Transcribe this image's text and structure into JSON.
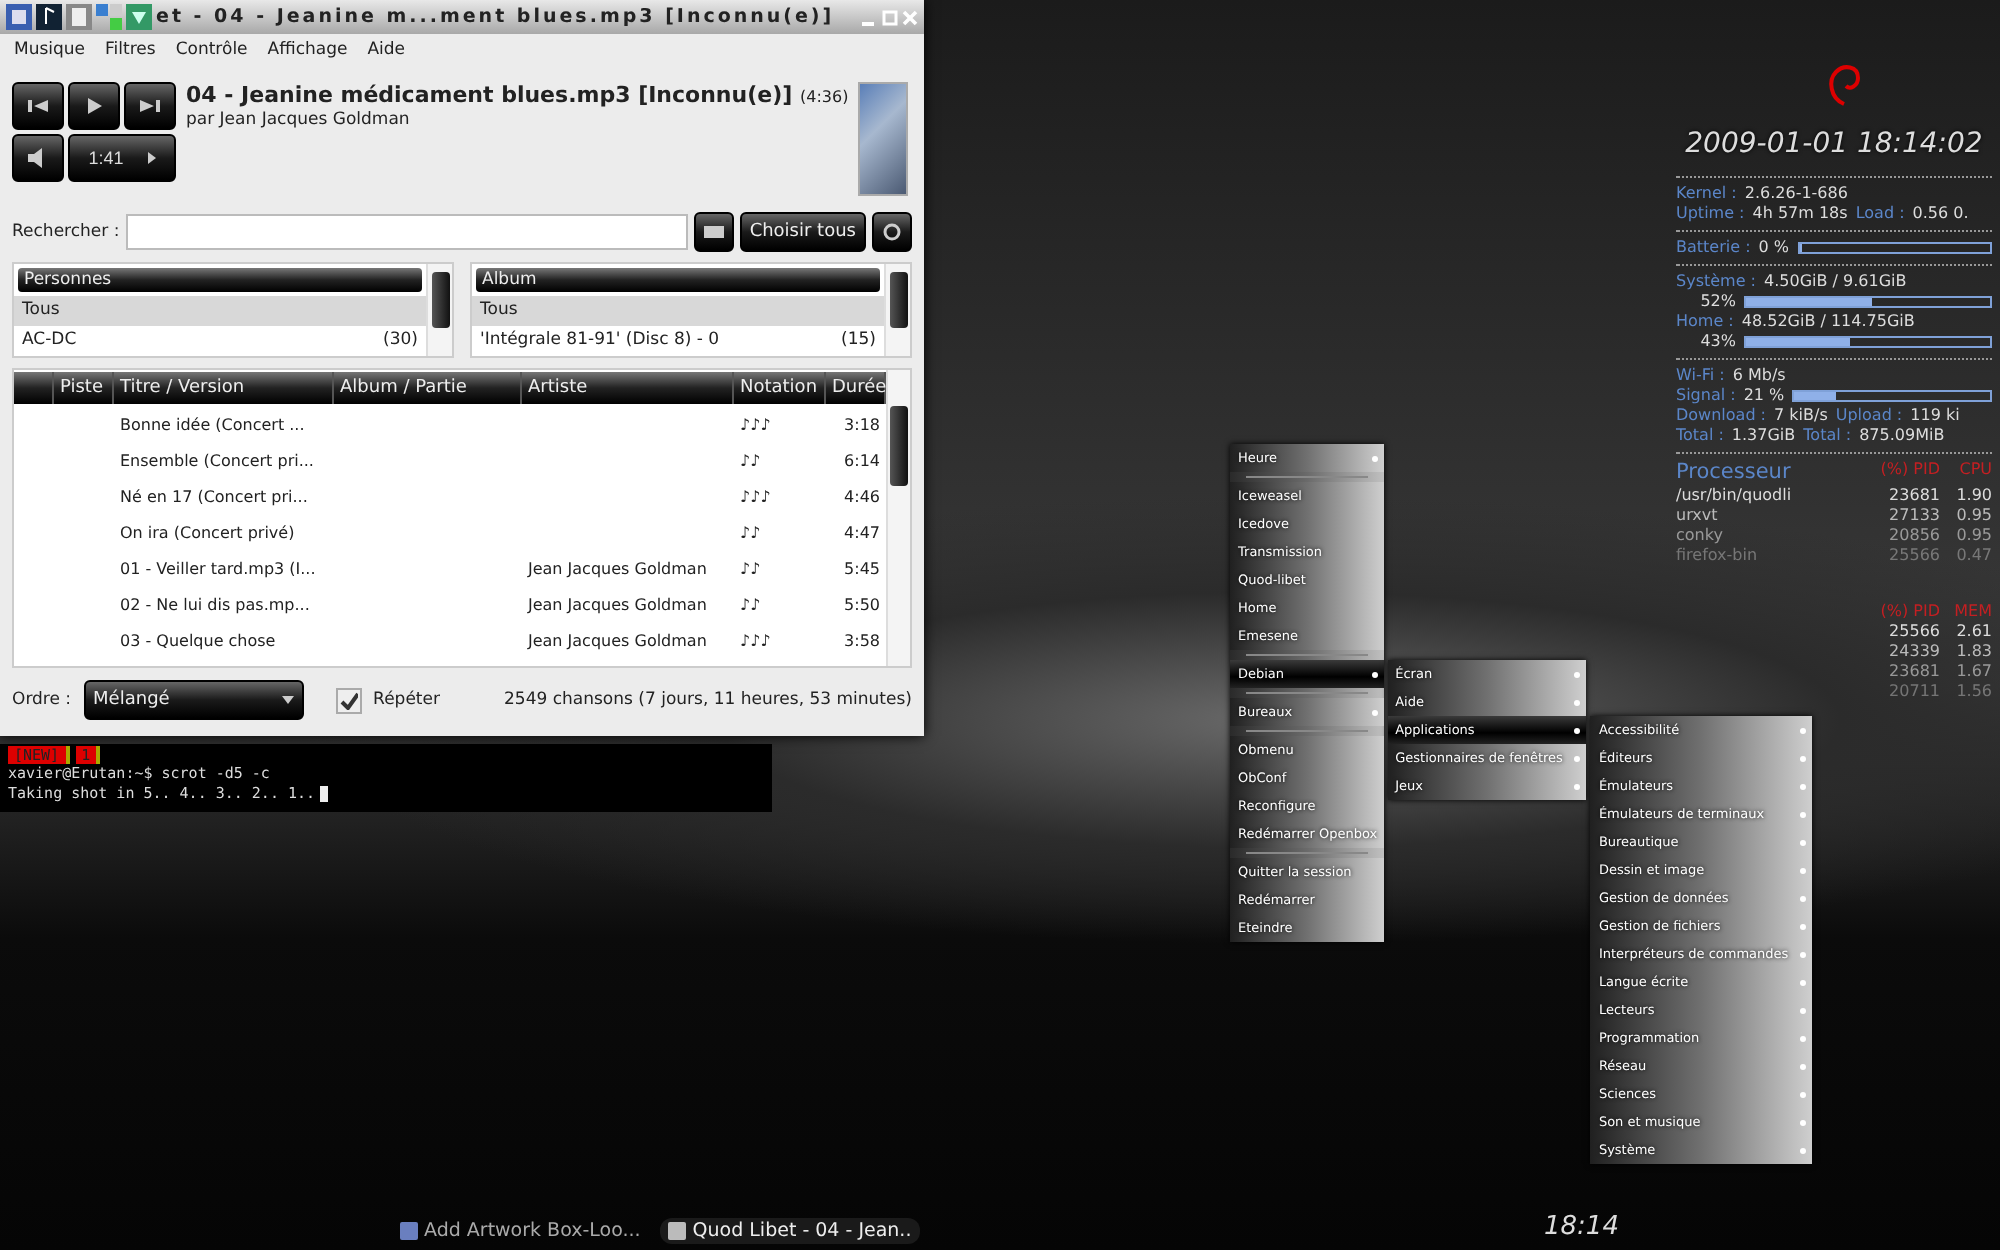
{
  "player": {
    "title": "et - 04 - Jeanine m...ment blues.mp3 [Inconnu(e)]",
    "menu": [
      "Musique",
      "Filtres",
      "Contrôle",
      "Affichage",
      "Aide"
    ],
    "song": {
      "title": "04 - Jeanine médicament blues.mp3 [Inconnu(e)]",
      "length": "(4:36)",
      "artist": "par Jean Jacques Goldman"
    },
    "position": "1:41",
    "search": {
      "label": "Rechercher :",
      "button": "Choisir tous"
    },
    "panes": [
      {
        "heading": "Personnes",
        "items": [
          {
            "name": "Tous",
            "selected": true
          },
          {
            "name": "AC-DC",
            "count": "(30)",
            "selected": false
          }
        ]
      },
      {
        "heading": "Album",
        "items": [
          {
            "name": "Tous",
            "selected": true
          },
          {
            "name": "'Intégrale 81-91' (Disc 8) - 0",
            "count": "(15)",
            "selected": false
          }
        ]
      }
    ],
    "columns": [
      "Piste",
      "Titre / Version",
      "Album / Partie",
      "Artiste",
      "Notation",
      "Durée"
    ],
    "rows": [
      {
        "title": "Bonne idée (Concert ...",
        "rating": "♪♪♪",
        "duration": "3:18"
      },
      {
        "title": "Ensemble (Concert pri...",
        "rating": "♪♪",
        "duration": "6:14"
      },
      {
        "title": "Né en 17 (Concert pri...",
        "rating": "♪♪♪",
        "duration": "4:46"
      },
      {
        "title": "On ira (Concert privé)",
        "rating": "♪♪",
        "duration": "4:47"
      },
      {
        "title": "01 - Veiller tard.mp3 (I...",
        "artist": "Jean Jacques Goldman",
        "rating": "♪♪",
        "duration": "5:45"
      },
      {
        "title": "02 - Ne lui dis pas.mp...",
        "artist": "Jean Jacques Goldman",
        "rating": "♪♪",
        "duration": "5:50"
      },
      {
        "title": "03 - Quelque chose",
        "artist": "Jean Jacques Goldman",
        "rating": "♪♪♪",
        "duration": "3:58"
      }
    ],
    "order": {
      "label": "Ordre :",
      "value": "Mélangé"
    },
    "repeat": {
      "label": "Répéter",
      "checked": true
    },
    "status": "2549 chansons (7 jours, 11 heures, 53 minutes)"
  },
  "terminal": {
    "tags": [
      "[NEW]",
      "1"
    ],
    "lines": [
      "xavier@Erutan:~$ scrot -d5 -c",
      "Taking shot in 5.. 4.. 3.. 2.. 1.."
    ]
  },
  "conky": {
    "datetime": "2009-01-01 18:14:02",
    "groups": [
      [
        {
          "kind": "text",
          "parts": [
            {
              "label": "Kernel :",
              "value": "2.6.26-1-686"
            }
          ]
        },
        {
          "kind": "text",
          "parts": [
            {
              "label": "Uptime :",
              "value": "4h 57m 18s"
            },
            {
              "label": "Load :",
              "value": "0.56 0."
            }
          ]
        }
      ],
      [
        {
          "kind": "bar",
          "label": "Batterie :",
          "value": "0 %",
          "level": 0
        }
      ],
      [
        {
          "kind": "text",
          "parts": [
            {
              "label": "Système :",
              "value": "4.50GiB / 9.61GiB"
            }
          ]
        },
        {
          "kind": "pct",
          "value": "52%",
          "level": 0.52
        },
        {
          "kind": "text",
          "parts": [
            {
              "label": "Home :",
              "value": "48.52GiB / 114.75GiB"
            }
          ]
        },
        {
          "kind": "pct",
          "value": "43%",
          "level": 0.43
        }
      ],
      [
        {
          "kind": "text",
          "parts": [
            {
              "label": "Wi-Fi :",
              "value": "6 Mb/s"
            }
          ]
        },
        {
          "kind": "bar",
          "label": "Signal :",
          "value": "21 %",
          "level": 0.21
        },
        {
          "kind": "text",
          "parts": [
            {
              "label": "Download :",
              "value": "7 kiB/s"
            },
            {
              "label": "Upload :",
              "value": "119 ki"
            }
          ]
        },
        {
          "kind": "text",
          "parts": [
            {
              "label": "Total :",
              "value": "1.37GiB"
            },
            {
              "label": "Total :",
              "value": "875.09MiB"
            }
          ]
        }
      ]
    ],
    "tables": [
      {
        "title": "Processeur",
        "headers": [
          "(%) PID",
          "CPU"
        ],
        "rows": [
          {
            "name": "/usr/bin/quodli",
            "pid": "23681",
            "value": "1.90"
          },
          {
            "name": "urxvt",
            "pid": "27133",
            "value": "0.95"
          },
          {
            "name": "conky",
            "pid": "20856",
            "value": "0.95"
          },
          {
            "name": "firefox-bin",
            "pid": "25566",
            "value": "0.47"
          }
        ]
      },
      {
        "headers": [
          "(%) PID",
          "MEM"
        ],
        "rows": [
          {
            "pid": "25566",
            "value": "2.61"
          },
          {
            "pid": "24339",
            "value": "1.83"
          },
          {
            "pid": "23681",
            "value": "1.67"
          },
          {
            "pid": "20711",
            "value": "1.56"
          }
        ]
      }
    ]
  },
  "menu": [
    {
      "kind": "submenu",
      "label": "Heure",
      "selected": false
    },
    {
      "kind": "separator"
    },
    {
      "kind": "item",
      "label": "Iceweasel",
      "selected": false
    },
    {
      "kind": "item",
      "label": "Icedove",
      "selected": false
    },
    {
      "kind": "item",
      "label": "Transmission",
      "selected": false
    },
    {
      "kind": "item",
      "label": "Quod-libet",
      "selected": false
    },
    {
      "kind": "item",
      "label": "Home",
      "selected": false
    },
    {
      "kind": "item",
      "label": "Emesene",
      "selected": false
    },
    {
      "kind": "separator"
    },
    {
      "kind": "submenu",
      "label": "Debian",
      "selected": true,
      "children": [
        {
          "kind": "submenu",
          "label": "Écran",
          "selected": false
        },
        {
          "kind": "submenu",
          "label": "Aide",
          "selected": false
        },
        {
          "kind": "submenu",
          "label": "Applications",
          "selected": true,
          "children": [
            {
              "kind": "submenu",
              "label": "Accessibilité",
              "selected": false
            },
            {
              "kind": "submenu",
              "label": "Éditeurs",
              "selected": false
            },
            {
              "kind": "submenu",
              "label": "Émulateurs",
              "selected": false
            },
            {
              "kind": "submenu",
              "label": "Émulateurs de terminaux",
              "selected": false
            },
            {
              "kind": "submenu",
              "label": "Bureautique",
              "selected": false
            },
            {
              "kind": "submenu",
              "label": "Dessin et image",
              "selected": false
            },
            {
              "kind": "submenu",
              "label": "Gestion de données",
              "selected": false
            },
            {
              "kind": "submenu",
              "label": "Gestion de fichiers",
              "selected": false
            },
            {
              "kind": "submenu",
              "label": "Interpréteurs de commandes",
              "selected": false
            },
            {
              "kind": "submenu",
              "label": "Langue écrite",
              "selected": false
            },
            {
              "kind": "submenu",
              "label": "Lecteurs",
              "selected": false
            },
            {
              "kind": "submenu",
              "label": "Programmation",
              "selected": false
            },
            {
              "kind": "submenu",
              "label": "Réseau",
              "selected": false
            },
            {
              "kind": "submenu",
              "label": "Sciences",
              "selected": false
            },
            {
              "kind": "submenu",
              "label": "Son et musique",
              "selected": false
            },
            {
              "kind": "submenu",
              "label": "Système",
              "selected": false
            }
          ]
        },
        {
          "kind": "submenu",
          "label": "Gestionnaires de fenêtres",
          "selected": false
        },
        {
          "kind": "submenu",
          "label": "Jeux",
          "selected": false
        }
      ]
    },
    {
      "kind": "separator"
    },
    {
      "kind": "submenu",
      "label": "Bureaux",
      "selected": false
    },
    {
      "kind": "separator"
    },
    {
      "kind": "item",
      "label": "Obmenu",
      "selected": false
    },
    {
      "kind": "item",
      "label": "ObConf",
      "selected": false
    },
    {
      "kind": "item",
      "label": "Reconfigure",
      "selected": false
    },
    {
      "kind": "item",
      "label": "Redémarrer Openbox",
      "selected": false
    },
    {
      "kind": "separator"
    },
    {
      "kind": "item",
      "label": "Quitter la session",
      "selected": false
    },
    {
      "kind": "item",
      "label": "Redémarrer",
      "selected": false
    },
    {
      "kind": "item",
      "label": "Eteindre",
      "selected": false
    }
  ],
  "taskbar": {
    "tasks": [
      {
        "label": "Add Artwork Box-Loo...",
        "selected": false
      },
      {
        "label": "Quod Libet - 04 - Jean..",
        "selected": true
      }
    ],
    "clock": "18:14"
  }
}
